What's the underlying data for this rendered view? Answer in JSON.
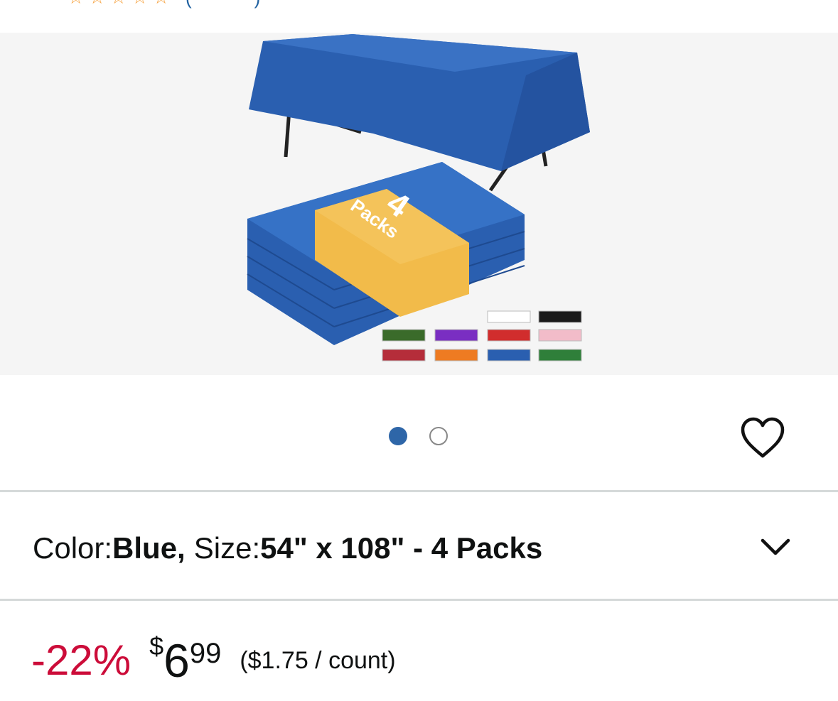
{
  "rating": {
    "stars": [
      "star-icon",
      "star-icon",
      "star-icon",
      "star-icon",
      "star-icon"
    ],
    "count_text": "(",
    "count_tail": ")"
  },
  "gallery": {
    "product_color": "#2a5fb0",
    "band_color": "#f2bb4a",
    "band_text_top": "4",
    "band_text_bottom": "Packs",
    "swatches": [
      "#ffffff",
      "#1a1a1a",
      "#3a6b2a",
      "#7a2ec2",
      "#d12d2d",
      "#f2bcc9",
      "#b52d3a",
      "#ee7b22",
      "#2a5fb0",
      "#2f7f3a"
    ]
  },
  "carousel": {
    "total": 2,
    "active_index": 0,
    "active_color": "#2e66a8"
  },
  "wishlist": {
    "icon": "heart-icon"
  },
  "variation": {
    "color_key": "Color: ",
    "color_value": "Blue,",
    "size_key": " Size: ",
    "size_value": "54\" x 108\" - 4 Packs",
    "chevron_icon": "chevron-down-icon"
  },
  "price": {
    "discount": "-22%",
    "currency": "$",
    "whole": "6",
    "fraction": "99",
    "unit_price": "($1.75 / count)",
    "discount_color": "#cc0c39"
  }
}
